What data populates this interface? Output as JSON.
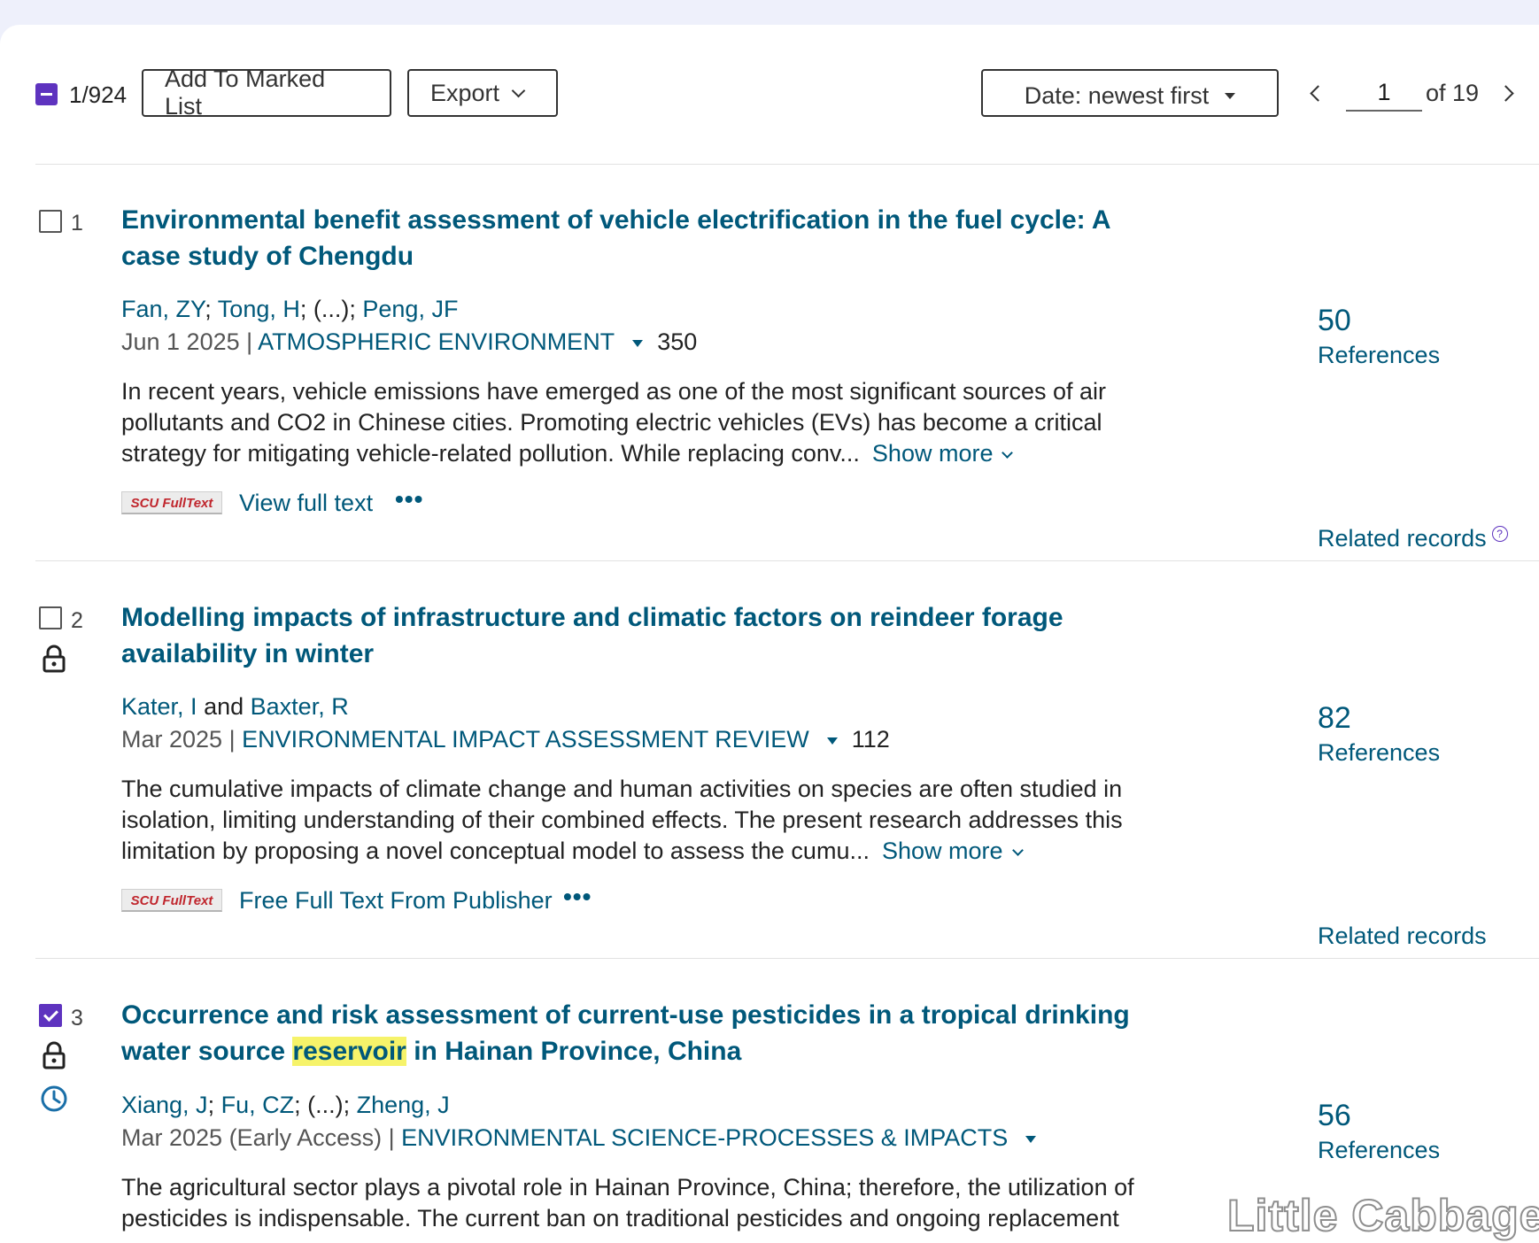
{
  "toolbar": {
    "selected_count": "1/924",
    "add_to_marked_list": "Add To Marked List",
    "export": "Export",
    "sort": "Date: newest first",
    "page_current": "1",
    "page_of": "of 19"
  },
  "records": [
    {
      "number": "1",
      "checked": false,
      "title": "Environmental benefit assessment of vehicle electrification in the fuel cycle: A case study of Chengdu",
      "authors": [
        "Fan, ZY",
        "Tong, H",
        "Peng, JF"
      ],
      "authors_sep": "; ",
      "authors_ellipsis": "(...)",
      "date": "Jun 1 2025",
      "journal": "ATMOSPHERIC ENVIRONMENT",
      "volume": "350",
      "abstract": "In recent years, vehicle emissions have emerged as one of the most significant sources of air pollutants and CO2 in Chinese cities. Promoting electric vehicles (EVs) has become a critical strategy for mitigating vehicle-related pollution. While replacing conv",
      "ellipsis": "...",
      "show_more": "Show more",
      "badge": "SCU FullText",
      "fulltext_link": "View full text",
      "more": "•••",
      "ref_count": "50",
      "ref_label": "References",
      "related": "Related records",
      "help": "?"
    },
    {
      "number": "2",
      "checked": false,
      "title": "Modelling impacts of infrastructure and climatic factors on reindeer forage availability in winter",
      "authors": [
        "Kater, I",
        "Baxter, R"
      ],
      "authors_and": "and",
      "date": "Mar 2025",
      "journal": "ENVIRONMENTAL IMPACT ASSESSMENT REVIEW",
      "volume": "112",
      "abstract": "The cumulative impacts of climate change and human activities on species are often studied in isolation, limiting understanding of their combined effects. The present research addresses this limitation by proposing a novel conceptual model to assess the cumu",
      "ellipsis": "...",
      "show_more": "Show more",
      "badge": "SCU FullText",
      "fulltext_link": "Free Full Text From Publisher",
      "more": "•••",
      "ref_count": "82",
      "ref_label": "References",
      "related": "Related records"
    },
    {
      "number": "3",
      "checked": true,
      "title_before": "Occurrence and risk assessment of current-use pesticides in a tropical drinking water source ",
      "title_highlight": "reservoir",
      "title_after": " in Hainan Province, China",
      "authors": [
        "Xiang, J",
        "Fu, CZ",
        "Zheng, J"
      ],
      "authors_ellipsis": "(...)",
      "date": "Mar 2025 (Early Access)",
      "journal": "ENVIRONMENTAL SCIENCE-PROCESSES & IMPACTS",
      "abstract": "The agricultural sector plays a pivotal role in Hainan Province, China; therefore, the utilization of pesticides is indispensable. The current ban on traditional pesticides and ongoing replacement",
      "ref_count": "56",
      "ref_label": "References"
    }
  ],
  "watermark": "Little Cabbage"
}
